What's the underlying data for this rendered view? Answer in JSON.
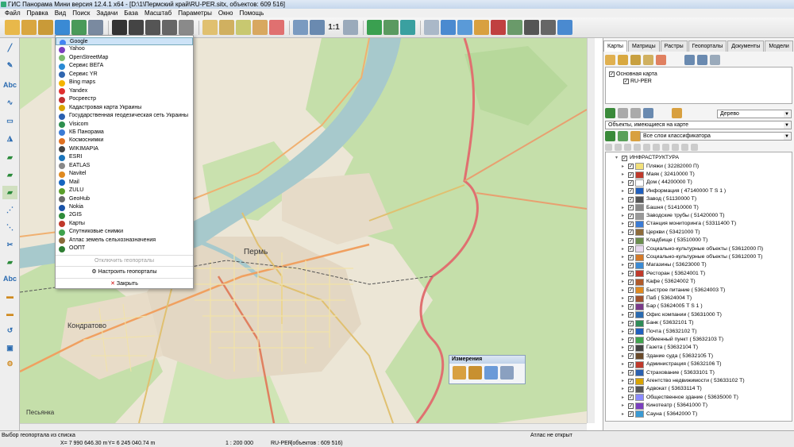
{
  "window": {
    "title": "ГИС Панорама Мини версия 12.4.1 x64 - [D:\\1\\Пермский край\\RU-PER.sitx, объектов: 609 516]"
  },
  "menu": [
    "Файл",
    "Правка",
    "Вид",
    "Поиск",
    "Задачи",
    "База",
    "Масштаб",
    "Параметры",
    "Окно",
    "Помощь"
  ],
  "toolbar": {
    "scale_button": "1:1"
  },
  "lefttools": {
    "text_label_1": "Abc",
    "text_label_2": "Abc"
  },
  "map": {
    "labels": {
      "city": "Пермь",
      "kondratovo": "Кондратово",
      "pesyanka": "Песьянка"
    }
  },
  "geoportals": {
    "items": [
      "Google",
      "Yahoo",
      "OpenStreetMap",
      "Сервис ВЕГА",
      "Сервис YR",
      "Bing maps",
      "Yandex",
      "Росреестр",
      "Кадастровая карта Украины",
      "Государственная геодезическая сеть Украины",
      "Visicom",
      "КБ Панорама",
      "Космоснимки",
      "WIKIMAPIA",
      "ESRI",
      "EATLAS",
      "Navitel",
      "Mail",
      "ZULU",
      "GeoHub",
      "Nokia",
      "2GIS",
      "Карты",
      "Спутниковые снимки",
      "Атлас земель сельхозназначения",
      "ООПТ"
    ],
    "icon_colors": [
      "#4285f4",
      "#7b3fbf",
      "#7ebc6f",
      "#2a8ad4",
      "#3066b0",
      "#f4b400",
      "#e03030",
      "#c03030",
      "#d9a400",
      "#2a60b0",
      "#2d8f4e",
      "#3a7bd5",
      "#e07020",
      "#444444",
      "#1b75bb",
      "#888888",
      "#e08a20",
      "#1565c0",
      "#5a9e2a",
      "#6a6a6a",
      "#1a53a8",
      "#2e8b3a",
      "#c0392b",
      "#3fa34d",
      "#8a6a3a",
      "#2e7d32"
    ],
    "selected": "Google",
    "disable_label": "Отключить геопорталы",
    "configure_label": "Настроить геопорталы",
    "close_label": "Закрыть"
  },
  "measure": {
    "title": "Измерения"
  },
  "panel": {
    "tabs": [
      "Карты",
      "Матрицы",
      "Растры",
      "Геопорталы",
      "Документы",
      "Модели"
    ],
    "active_tab": "Карты",
    "tree": {
      "root": "Основная карта",
      "child": "RU-PER"
    },
    "view_mode": "Дерево",
    "filter": "Объекты, имеющиеся на карте",
    "layers": "Все слои классификатора",
    "group": "ИНФРАСТРУКТУРА",
    "objects": [
      {
        "label": "Пляжи ( 32282000 П)",
        "color": "#f2e07a"
      },
      {
        "label": "Маяк ( 32410000 Т)",
        "color": "#c0392b"
      },
      {
        "label": "Дом ( 44200000 Т)",
        "color": "#ffffff"
      },
      {
        "label": "Информация ( 47140000 Т S 1 )",
        "color": "#1f5fbf"
      },
      {
        "label": "Завод ( 51130000 Т)",
        "color": "#555555"
      },
      {
        "label": "Башня ( 51410000 Т)",
        "color": "#888888"
      },
      {
        "label": "Заводские трубы ( 51420000 Т)",
        "color": "#999999"
      },
      {
        "label": "Станция мониторинга ( 53311400 Т)",
        "color": "#3a7bd5"
      },
      {
        "label": "Церкви ( 53421000 Т)",
        "color": "#8e6b3a"
      },
      {
        "label": "Кладбище ( 53510000 Т)",
        "color": "#6b8e4e"
      },
      {
        "label": "Социально-культурные объекты ( 53612000 П)",
        "color": "#e8d9f0"
      },
      {
        "label": "Социально-культурные объекты ( 53612000 Т)",
        "color": "#d47a2a"
      },
      {
        "label": "Магазины ( 53623000 Т)",
        "color": "#3a8ad4"
      },
      {
        "label": "Ресторан ( 53624001 Т)",
        "color": "#c0392b"
      },
      {
        "label": "Кафе ( 53624002 Т)",
        "color": "#b05a2a"
      },
      {
        "label": "Быстрое питание ( 53624003 Т)",
        "color": "#e08a20"
      },
      {
        "label": "Паб ( 53624004 Т)",
        "color": "#a0522d"
      },
      {
        "label": "Бар ( 53624005 Т S 1 )",
        "color": "#7a3a8a"
      },
      {
        "label": "Офис компании ( 53631000 Т)",
        "color": "#2a6ab0"
      },
      {
        "label": "Банк ( 53632101 Т)",
        "color": "#2e8b57"
      },
      {
        "label": "Почта ( 53632102 Т)",
        "color": "#1f5fbf"
      },
      {
        "label": "Обменный пункт ( 53632103 Т)",
        "color": "#3fa34d"
      },
      {
        "label": "Газета ( 53632104 Т)",
        "color": "#444444"
      },
      {
        "label": "Здание суда ( 53632105 Т)",
        "color": "#6a4a2a"
      },
      {
        "label": "Администрация ( 53632106 Т)",
        "color": "#c0392b"
      },
      {
        "label": "Страхование ( 53633101 Т)",
        "color": "#2a60b0"
      },
      {
        "label": "Агентство недвижимости ( 53633102 Т)",
        "color": "#d9a400"
      },
      {
        "label": "Адвокат ( 53633114 Т)",
        "color": "#555555"
      },
      {
        "label": "Общественное здание ( 53635000 Т)",
        "color": "#8a8aff"
      },
      {
        "label": "Кинотеатр ( 53641000 Т)",
        "color": "#7b3fbf"
      },
      {
        "label": "Сауна ( 53642000 Т)",
        "color": "#3a9ad4"
      }
    ]
  },
  "status": {
    "hint": "Выбор геопортала из списка",
    "atlas": "Атлас не открыт",
    "x": "X= 7 990 646.30 m",
    "y": "Y= 6 245 040.74 m",
    "scale": "1 : 200 000",
    "map_name": "RU-PER",
    "objects": "(объектов : 609 516)"
  }
}
